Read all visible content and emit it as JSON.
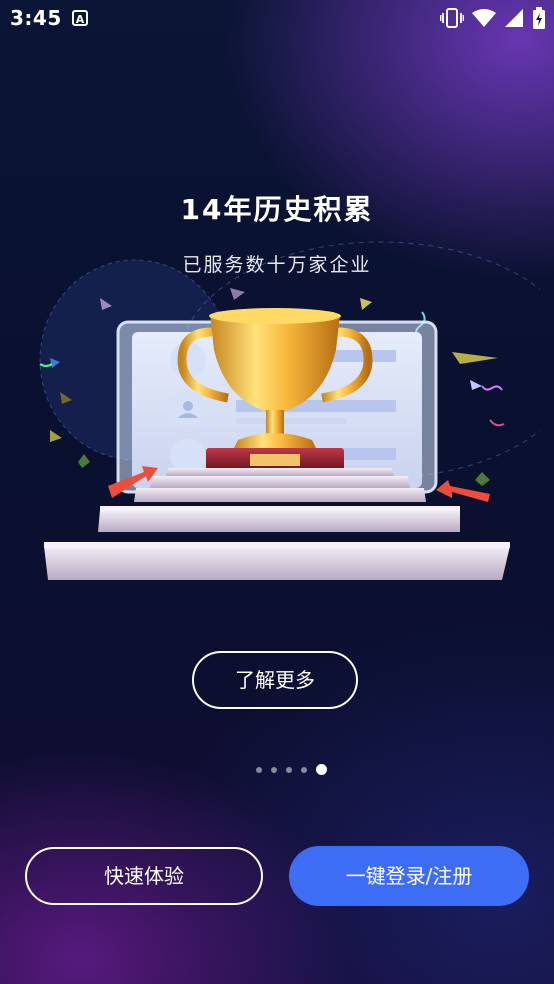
{
  "status_bar": {
    "time": "3:45",
    "notification_icon_letter": "A",
    "icons": [
      "vibrate-icon",
      "wifi-icon",
      "signal-icon",
      "battery-icon"
    ]
  },
  "hero": {
    "title": "14年历史积累",
    "subtitle": "已服务数十万家企业"
  },
  "learn_more_label": "了解更多",
  "pager": {
    "count": 5,
    "active_index": 4
  },
  "buttons": {
    "quick_experience": "快速体验",
    "one_click_login": "一键登录/注册"
  },
  "colors": {
    "primary_button": "#3d6df5",
    "background_top": "#0b1535",
    "accent_purple": "#6a3cc8"
  }
}
